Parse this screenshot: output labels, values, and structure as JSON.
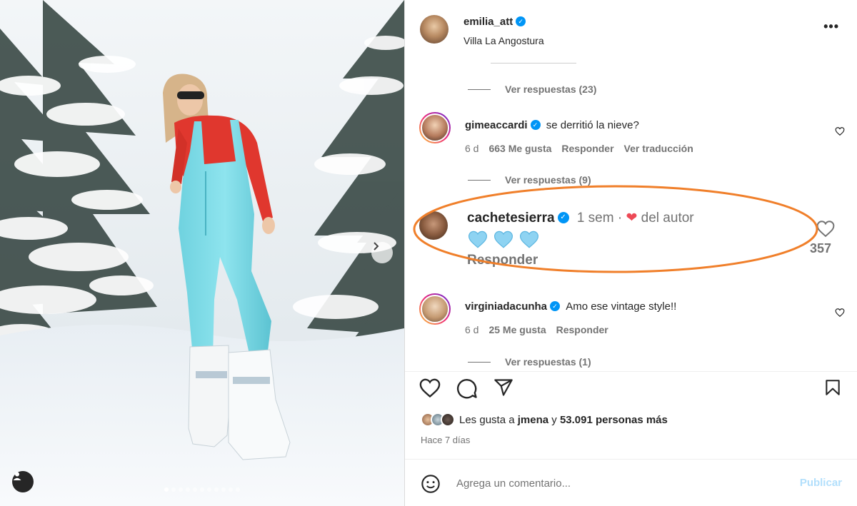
{
  "post": {
    "author": "emilia_att",
    "location": "Villa La Angostura",
    "carousel_total": 11,
    "carousel_active": 1
  },
  "comments": {
    "view_replies_1": "Ver respuestas (23)",
    "c1": {
      "user": "gimeaccardi",
      "text": "se derritió la nieve?",
      "time": "6 d",
      "likes": "663 Me gusta",
      "reply": "Responder",
      "translate": "Ver traducción"
    },
    "view_replies_2": "Ver respuestas (9)",
    "highlight": {
      "user": "cachetesierra",
      "time": "1 sem",
      "sep": "·",
      "author_label": "del autor",
      "hearts": [
        "light-blue-heart",
        "light-blue-heart",
        "light-blue-heart"
      ],
      "reply": "Responder",
      "likes": "357"
    },
    "c2": {
      "user": "virginiadacunha",
      "text": "Amo ese vintage style!!",
      "time": "6 d",
      "likes": "25 Me gusta",
      "reply": "Responder"
    },
    "view_replies_3": "Ver respuestas (1)"
  },
  "likes": {
    "prefix": "Les gusta a",
    "first_user": "jmena",
    "connector": "y",
    "rest": "53.091 personas más"
  },
  "date": "Hace 7 días",
  "composer": {
    "placeholder": "Agrega un comentario...",
    "publish": "Publicar"
  },
  "colors": {
    "verified": "#0095f6",
    "highlight_ring": "#f07f2a",
    "author_heart": "#ed4956",
    "heart_emoji": "#8ed3f2",
    "publish_disabled": "#b2dffc",
    "outfit": "#7fdbe6",
    "sweater": "#e0372e"
  }
}
